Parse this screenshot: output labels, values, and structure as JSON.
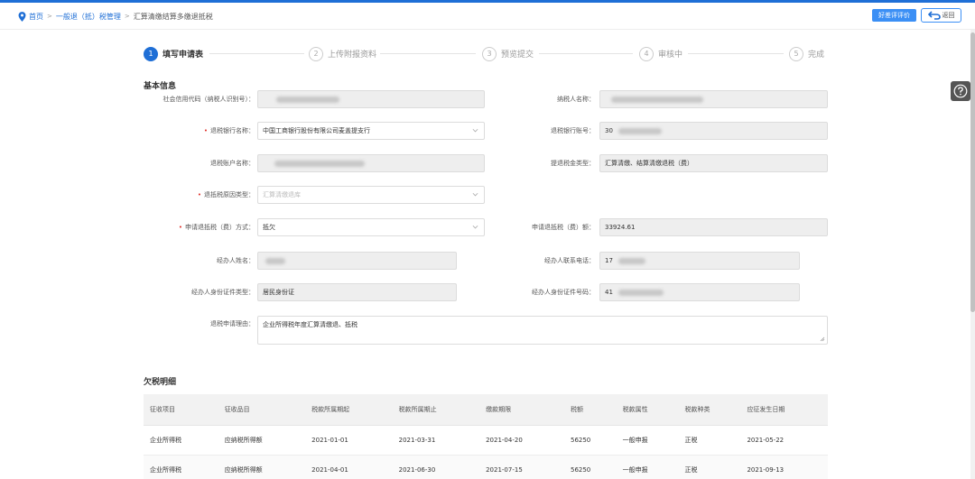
{
  "breadcrumb": {
    "home": "首页",
    "level1": "一般退（抵）税管理",
    "current": "汇算清缴结算多缴退抵税"
  },
  "header": {
    "rate_button": "好差评评价",
    "back_button": "返回"
  },
  "steps": [
    {
      "num": "1",
      "label": "填写申请表",
      "active": true
    },
    {
      "num": "2",
      "label": "上传附报资料",
      "active": false
    },
    {
      "num": "3",
      "label": "预览提交",
      "active": false
    },
    {
      "num": "4",
      "label": "审核中",
      "active": false
    },
    {
      "num": "5",
      "label": "完成",
      "active": false
    }
  ],
  "basic": {
    "title": "基本信息",
    "credit_code_label": "社会信用代码（纳税人识别号）：",
    "taxpayer_name_label": "纳税人名称：",
    "bank_name_label": "退税银行名称：",
    "bank_name_value": "中国工商银行股份有限公司麦盖提支行",
    "bank_account_label": "退税银行账号：",
    "bank_account_value": "30",
    "account_holder_label": "退税账户名称：",
    "tax_type_label": "提退税金类型：",
    "tax_type_value": "汇算清缴、结算清缴退税（费）",
    "reason_type_label": "退抵税原因类型：",
    "reason_type_placeholder": "汇算清缴退库",
    "method_label": "申请退抵税（费）方式：",
    "method_value": "抵欠",
    "amount_label": "申请退抵税（费）额：",
    "amount_value": "33924.61",
    "agent_name_label": "经办人姓名：",
    "agent_phone_label": "经办人联系电话：",
    "agent_phone_value": "17",
    "id_type_label": "经办人身份证件类型：",
    "id_type_value": "居民身份证",
    "id_number_label": "经办人身份证件号码：",
    "id_number_value": "41",
    "reason_label": "退税申请理由：",
    "reason_value": "企业所得税年度汇算清缴退、抵税"
  },
  "arrears": {
    "title": "欠税明细",
    "columns": [
      "征收项目",
      "征收品目",
      "税款所属期起",
      "税款所属期止",
      "缴款期限",
      "税额",
      "税款属性",
      "税款种类",
      "应征发生日期"
    ],
    "rows": [
      [
        "企业所得税",
        "应纳税所得额",
        "2021-01-01",
        "2021-03-31",
        "2021-04-20",
        "56250",
        "一般申报",
        "正税",
        "2021-05-22"
      ],
      [
        "企业所得税",
        "应纳税所得额",
        "2021-04-01",
        "2021-06-30",
        "2021-07-15",
        "56250",
        "一般申报",
        "正税",
        "2021-09-13"
      ]
    ]
  },
  "colors": {
    "accent": "#1f6fd6",
    "required": "#e0322b",
    "disabled_bg": "#eeeeee"
  }
}
